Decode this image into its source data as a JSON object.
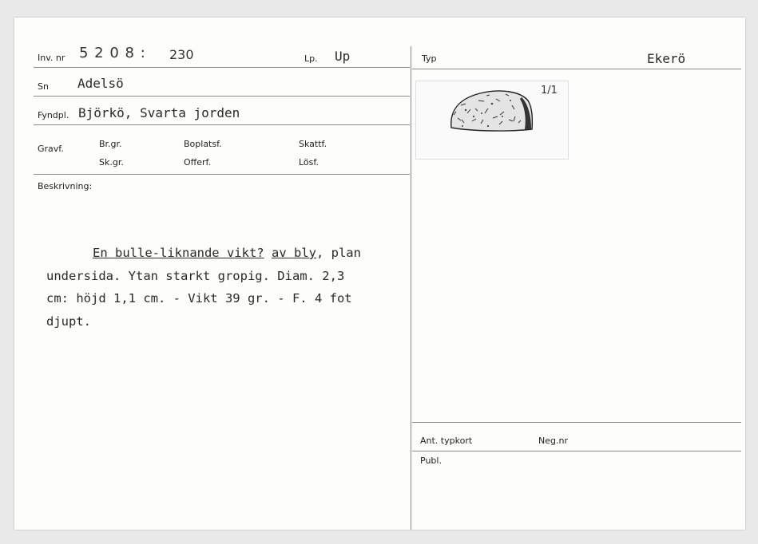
{
  "labels": {
    "inv_nr": "Inv. nr",
    "lp": "Lp.",
    "sn": "Sn",
    "fyndpl": "Fyndpl.",
    "gravf": "Gravf.",
    "br_gr": "Br.gr.",
    "sk_gr": "Sk.gr.",
    "boplatsf": "Boplatsf.",
    "offerf": "Offerf.",
    "skattf": "Skattf.",
    "losf": "Lösf.",
    "beskrivning": "Beskrivning:",
    "typ": "Typ",
    "ant_typkort": "Ant. typkort",
    "neg_nr": "Neg.nr",
    "publ": "Publ."
  },
  "values": {
    "inv_nr_main": "5 2 0 8 :",
    "inv_nr_sub": "230",
    "lp": "Up",
    "sn": "Adelsö",
    "fyndpl": "Björkö, Svarta jorden",
    "typ": "Ekerö",
    "scale": "1/1"
  },
  "description": {
    "line1_underlined_a": "En bulle-liknande vikt?",
    "line1_underlined_b": "av bly",
    "line1_rest": ", plan",
    "line2": "undersida. Ytan starkt gropig. Diam. 2,3",
    "line3": "cm: höjd 1,1 cm. - Vikt 39 gr. - F. 4 fot",
    "line4": "djupt."
  },
  "icons": {
    "sketch": "lead-weight-sketch"
  }
}
